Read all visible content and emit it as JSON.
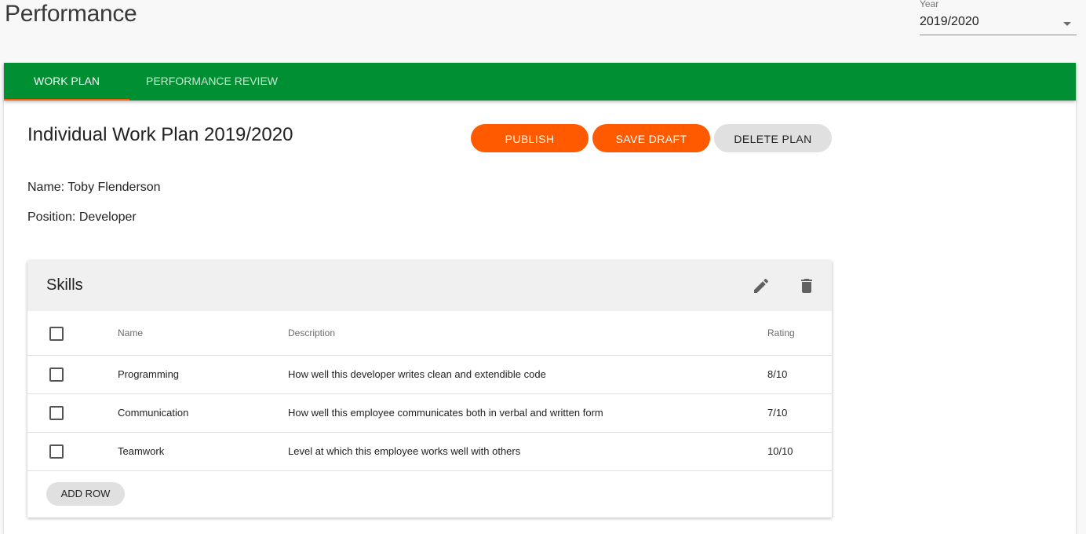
{
  "page": {
    "title": "Performance"
  },
  "year_select": {
    "label": "Year",
    "value": "2019/2020"
  },
  "tabs": [
    {
      "label": "WORK PLAN",
      "active": true
    },
    {
      "label": "PERFORMANCE REVIEW",
      "active": false
    }
  ],
  "plan": {
    "title": "Individual Work Plan 2019/2020",
    "name_line": "Name: Toby Flenderson",
    "position_line": "Position: Developer"
  },
  "actions": {
    "publish": "PUBLISH",
    "save_draft": "SAVE DRAFT",
    "delete_plan": "DELETE PLAN"
  },
  "skills": {
    "title": "Skills",
    "icons": {
      "edit": "pencil-icon",
      "delete": "trash-icon"
    },
    "columns": {
      "name": "Name",
      "description": "Description",
      "rating": "Rating"
    },
    "rows": [
      {
        "name": "Programming",
        "description": "How well this developer writes clean and extendible code",
        "rating": "8/10"
      },
      {
        "name": "Communication",
        "description": "How well this employee communicates both in verbal and written form",
        "rating": "7/10"
      },
      {
        "name": "Teamwork",
        "description": "Level at which this employee works well with others",
        "rating": "10/10"
      }
    ],
    "add_row": "ADD ROW"
  },
  "colors": {
    "tab_bar": "#008f33",
    "accent": "#ff5a00",
    "button_grey": "#e0e0e0"
  }
}
